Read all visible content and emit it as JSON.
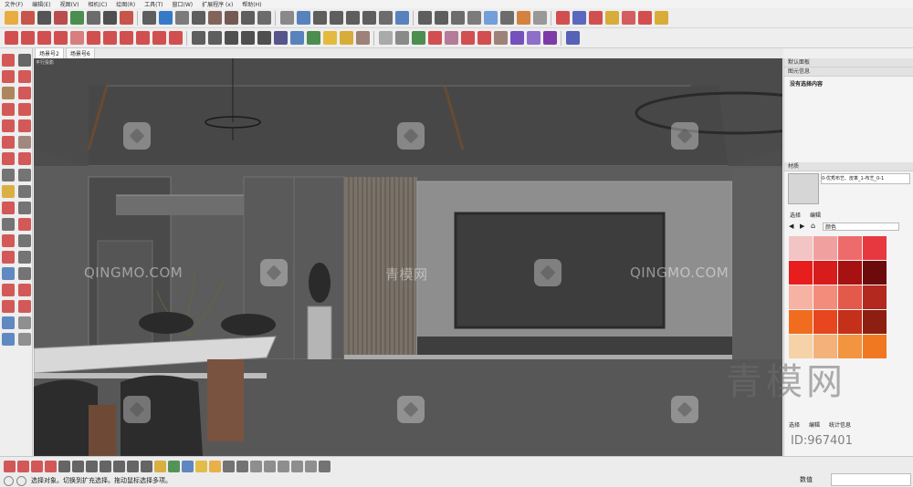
{
  "menu": [
    "文件(F)",
    "编辑(E)",
    "视图(V)",
    "相机(C)",
    "绘图(R)",
    "工具(T)",
    "窗口(W)",
    "扩展程序 (x)",
    "帮助(H)"
  ],
  "toolbar_rows": {
    "row1": [
      "#e8a020",
      "#c0392b",
      "#3a3a3a",
      "#b03030",
      "#2e7d32",
      "#555555",
      "#333333",
      "#c0392b",
      "#444444",
      "#1565c0",
      "#666666",
      "#444444",
      "#6d4c41",
      "#5d4037",
      "#444444",
      "#555555",
      "#777777",
      "#3d6fb5",
      "#444444",
      "#444444",
      "#444444",
      "#444444",
      "#555555",
      "#3d6fb5",
      "#444444",
      "#444444",
      "#555555",
      "#666666",
      "#5c8fd6",
      "#555555",
      "#cf6f20",
      "#888888",
      "#cc3333",
      "#3f51b5",
      "#cc3333",
      "#d4a017",
      "#cc4444",
      "#cc3333",
      "#d4a017"
    ],
    "row2": [
      "#cc3333",
      "#cc3333",
      "#cc3333",
      "#cc3333",
      "#d46a6a",
      "#cc3333",
      "#cc3333",
      "#cc3333",
      "#cc3333",
      "#cc3333",
      "#cc3333",
      "#444444",
      "#444444",
      "#333333",
      "#333333",
      "#333333",
      "#3a3a7a",
      "#3d6fb5",
      "#2e7d32",
      "#e0b020",
      "#d4a017",
      "#8d6e63",
      "#9e9e9e",
      "#777777",
      "#2e7d32",
      "#cc3333",
      "#aa6688",
      "#cc3333",
      "#cc3333",
      "#8d6e63",
      "#5e35b1",
      "#7e57c2",
      "#6a1b9a",
      "#3949ab"
    ]
  },
  "scene_tabs": [
    "场景号2",
    "场景号6"
  ],
  "viewport": {
    "label": "平行投影"
  },
  "watermarks": {
    "text1": "QINGMO.COM",
    "text2": "青模网",
    "text3": "QINGMO.COM",
    "text4": "QINGMO.COM"
  },
  "right_panel": {
    "default_tray": "默认面板",
    "entity_info": "图元信息",
    "no_selection": "没有选择内容",
    "materials": "材质",
    "material_name": "0-优秀布艺、皮革_1-布艺_0-1",
    "tab_select": "选择",
    "tab_edit": "编辑",
    "color_set": "颜色",
    "bottom_tab_select": "选择",
    "bottom_tab_edit": "编辑",
    "bottom_tab_stats": "统计信息",
    "swatches": [
      "#f3c4c4",
      "#f1a0a0",
      "#ee6b6b",
      "#e8383f",
      "#e81e1e",
      "#d81b1b",
      "#a61212",
      "#6b0b0b",
      "#f6b3a3",
      "#f48c7c",
      "#e45a4a",
      "#b3281f",
      "#f06d20",
      "#e8461e",
      "#c4301a",
      "#8c1e12",
      "#f6d2a8",
      "#f4b27a",
      "#f29440",
      "#f07820"
    ]
  },
  "status": {
    "text": "选择对象。切换到扩充选择。拖动鼠标选择多项。",
    "vcb_label": "数值",
    "bottom_tool_colors": [
      "#cc3333",
      "#cc3333",
      "#cc3333",
      "#cc3333",
      "#444444",
      "#444444",
      "#444444",
      "#444444",
      "#444444",
      "#444444",
      "#444444",
      "#d4a017",
      "#2e7d32",
      "#3d6fb5",
      "#e0b020",
      "#e8a020",
      "#555555",
      "#555555",
      "#777777",
      "#777777",
      "#777777",
      "#777777",
      "#777777",
      "#555555"
    ]
  },
  "overlay": {
    "big_watermark": "青模网",
    "id": "ID:967401"
  }
}
